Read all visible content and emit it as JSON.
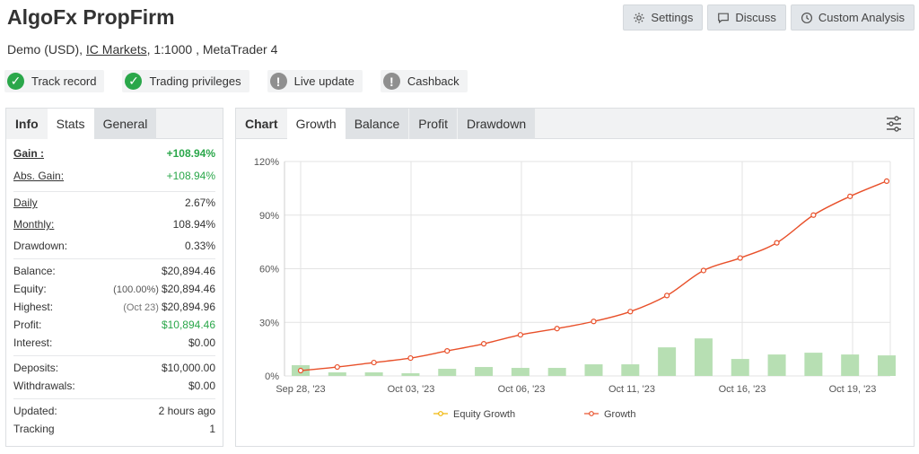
{
  "header": {
    "title": "AlgoFx PropFirm",
    "subtitle_prefix": "Demo (USD), ",
    "broker": "IC Markets",
    "subtitle_suffix": ", 1:1000 , MetaTrader 4",
    "buttons": {
      "settings": "Settings",
      "discuss": "Discuss",
      "custom_analysis": "Custom Analysis"
    }
  },
  "badges": [
    {
      "label": "Track record",
      "status": "ok"
    },
    {
      "label": "Trading privileges",
      "status": "ok"
    },
    {
      "label": "Live update",
      "status": "warn"
    },
    {
      "label": "Cashback",
      "status": "warn"
    }
  ],
  "left_tabs": {
    "info": "Info",
    "stats": "Stats",
    "general": "General"
  },
  "stats": {
    "gain": {
      "label": "Gain :",
      "value": "+108.94%"
    },
    "abs_gain": {
      "label": "Abs. Gain:",
      "value": "+108.94%"
    },
    "daily": {
      "label": "Daily",
      "value": "2.67%"
    },
    "monthly": {
      "label": "Monthly:",
      "value": "108.94%"
    },
    "drawdown": {
      "label": "Drawdown:",
      "value": "0.33%"
    },
    "balance": {
      "label": "Balance:",
      "value": "$20,894.46"
    },
    "equity": {
      "label": "Equity:",
      "pre": "(100.00%)",
      "value": "$20,894.46"
    },
    "highest": {
      "label": "Highest:",
      "pre": "(Oct 23)",
      "value": "$20,894.96"
    },
    "profit": {
      "label": "Profit:",
      "value": "$10,894.46"
    },
    "interest": {
      "label": "Interest:",
      "value": "$0.00"
    },
    "deposits": {
      "label": "Deposits:",
      "value": "$10,000.00"
    },
    "withdrawals": {
      "label": "Withdrawals:",
      "value": "$0.00"
    },
    "updated": {
      "label": "Updated:",
      "value": "2 hours ago"
    },
    "tracking": {
      "label": "Tracking",
      "value": "1"
    }
  },
  "chart_tabs": {
    "chart": "Chart",
    "growth": "Growth",
    "balance": "Balance",
    "profit": "Profit",
    "drawdown": "Drawdown"
  },
  "colors": {
    "growth_line": "#e8502a",
    "equity_line": "#f0b400",
    "bars": "#b7dfb3",
    "green": "#2aa74a"
  },
  "chart_data": {
    "type": "line",
    "ylim": [
      0,
      120
    ],
    "yticks": [
      "0%",
      "30%",
      "60%",
      "90%",
      "120%"
    ],
    "xticks": [
      "Sep 28, '23",
      "Oct 03, '23",
      "Oct 06, '23",
      "Oct 11, '23",
      "Oct 16, '23",
      "Oct 19, '23"
    ],
    "legend": [
      "Equity Growth",
      "Growth"
    ],
    "series": [
      {
        "name": "Growth",
        "values": [
          3,
          5,
          7.5,
          10,
          14,
          18,
          23,
          26.5,
          30.5,
          36,
          45,
          59,
          66,
          74.5,
          90,
          100.5,
          109
        ]
      },
      {
        "name": "Equity Growth",
        "values": []
      }
    ],
    "bars": [
      6,
      2,
      2,
      1.5,
      4,
      5,
      4.5,
      4.5,
      6.5,
      6.5,
      16,
      21,
      9.5,
      12,
      13,
      12,
      11.5
    ]
  }
}
